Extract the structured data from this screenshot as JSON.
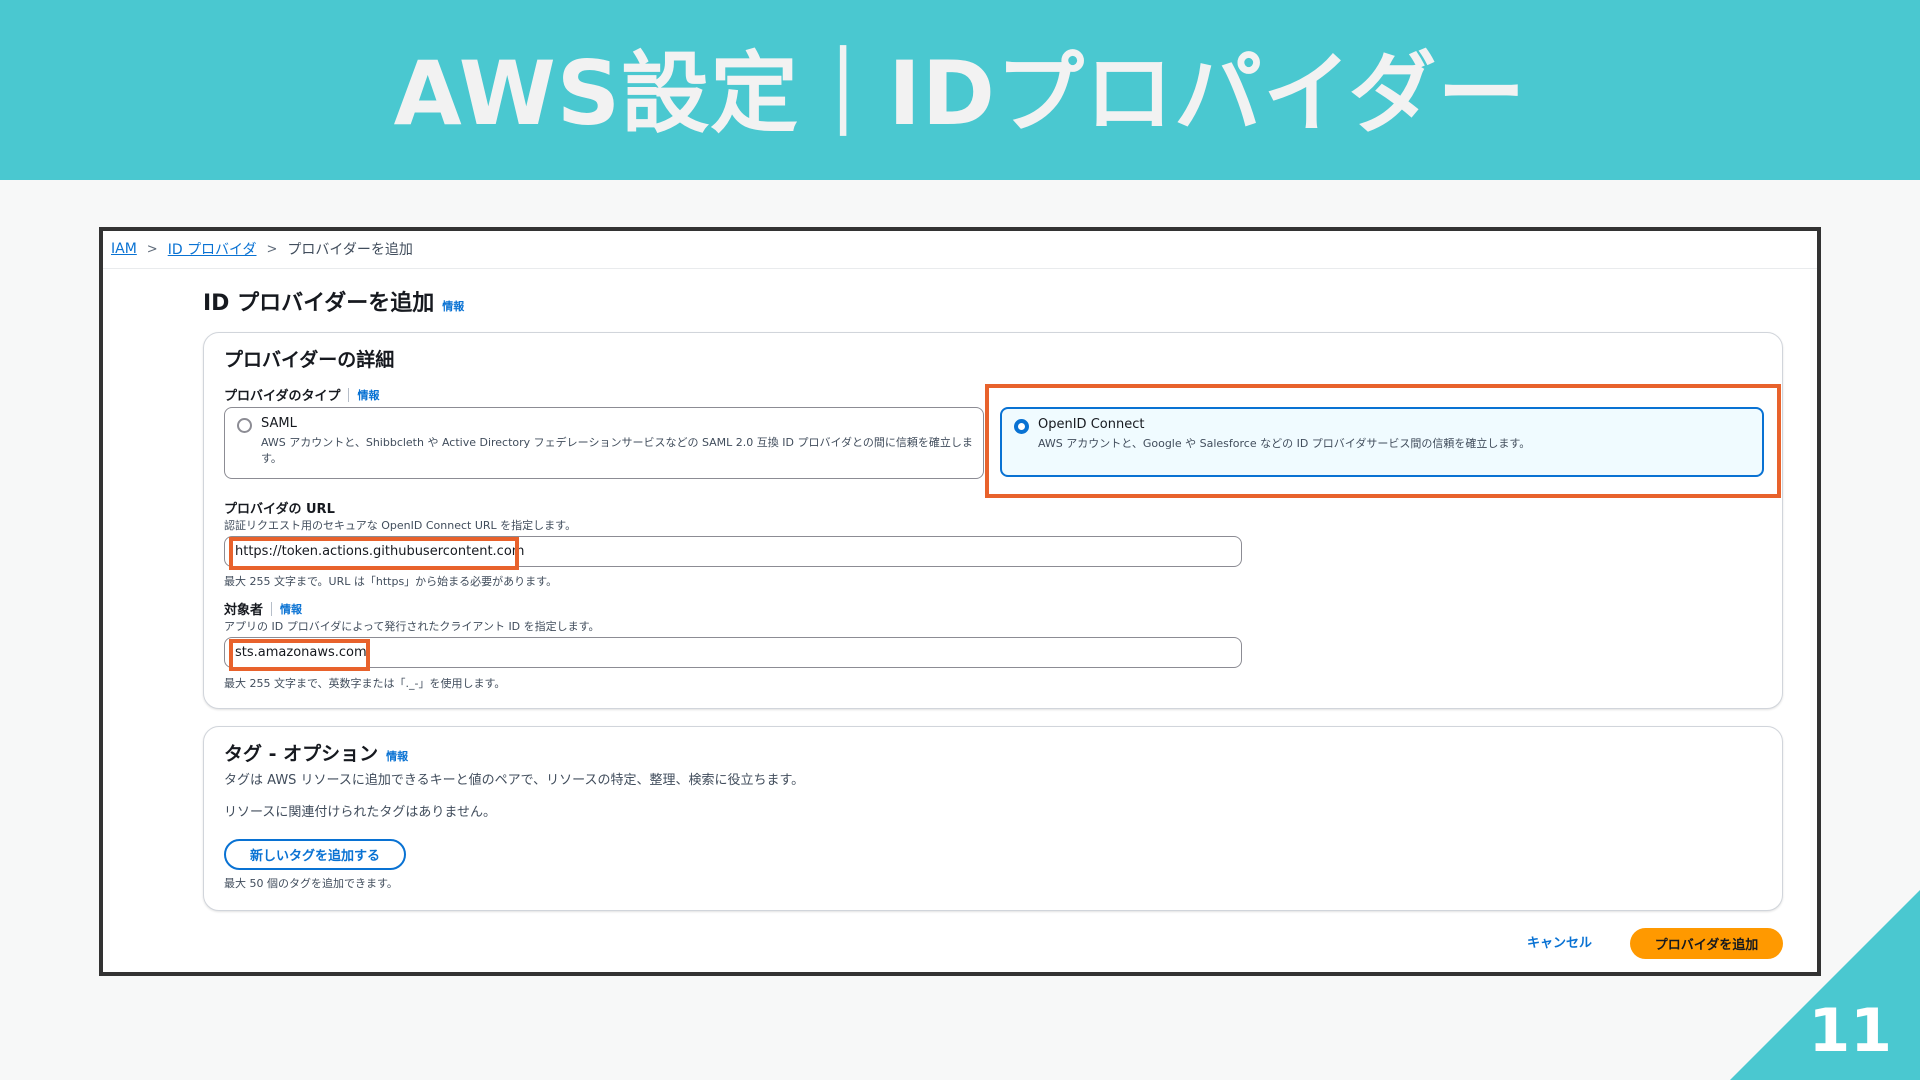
{
  "slide": {
    "title": "AWS設定｜IDプロパイダー",
    "page_number": "11"
  },
  "breadcrumb": {
    "items": [
      "IAM",
      "ID プロバイダ",
      "プロバイダーを追加"
    ]
  },
  "page": {
    "title": "ID プロバイダーを追加",
    "info": "情報"
  },
  "details": {
    "heading": "プロバイダーの詳細",
    "type_label": "プロバイダのタイプ",
    "type_info": "情報",
    "saml": {
      "title": "SAML",
      "desc": "AWS アカウントと、Shibbcleth や Active Directory フェデレーションサービスなどの SAML 2.0 互換 ID プロバイダとの間に信頼を確立します。",
      "selected": false
    },
    "oidc": {
      "title": "OpenID Connect",
      "desc": "AWS アカウントと、Google や Salesforce などの ID プロバイダサービス間の信頼を確立します。",
      "selected": true
    },
    "url_label": "プロバイダの URL",
    "url_desc": "認証リクエスト用のセキュアな OpenID Connect URL を指定します。",
    "url_value": "https://token.actions.githubusercontent.com",
    "url_hint": "最大 255 文字まで。URL は「https」から始まる必要があります。",
    "audience_label": "対象者",
    "audience_info": "情報",
    "audience_desc": "アプリの ID プロバイダによって発行されたクライアント ID を指定します。",
    "audience_value": "sts.amazonaws.com",
    "audience_hint": "最大 255 文字まで、英数字または「._-」を使用します。"
  },
  "tags": {
    "heading": "タグ - オプション",
    "info": "情報",
    "desc": "タグは AWS リソースに追加できるキーと値のペアで、リソースの特定、整理、検索に役立ちます。",
    "empty": "リソースに関連付けられたタグはありません。",
    "add_button": "新しいタグを追加する",
    "limit": "最大 50 個のタグを追加できます。"
  },
  "footer": {
    "cancel": "キャンセル",
    "submit": "プロバイダを追加"
  },
  "colors": {
    "header_bg": "#4ac8d0",
    "highlight": "#e8622c",
    "link": "#0972d3",
    "primary_button": "#ff9900"
  }
}
